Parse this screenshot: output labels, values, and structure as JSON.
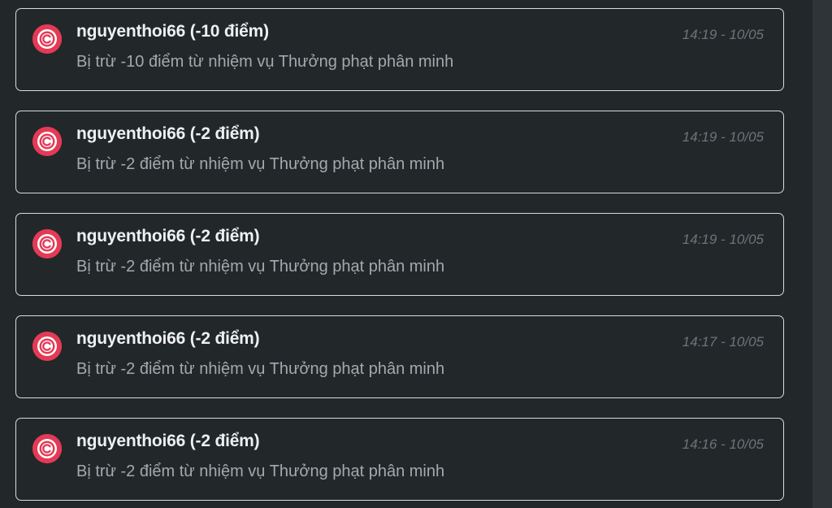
{
  "notifications": [
    {
      "title": "nguyenthoi66 (-10 điểm)",
      "description": "Bị trừ -10 điểm từ nhiệm vụ Thưởng phạt phân minh",
      "time": "14:19 - 10/05",
      "avatar_icon": "red-target-c-logo-icon"
    },
    {
      "title": "nguyenthoi66 (-2 điểm)",
      "description": "Bị trừ -2 điểm từ nhiệm vụ Thưởng phạt phân minh",
      "time": "14:19 - 10/05",
      "avatar_icon": "red-target-c-logo-icon"
    },
    {
      "title": "nguyenthoi66 (-2 điểm)",
      "description": "Bị trừ -2 điểm từ nhiệm vụ Thưởng phạt phân minh",
      "time": "14:19 - 10/05",
      "avatar_icon": "red-target-c-logo-icon"
    },
    {
      "title": "nguyenthoi66 (-2 điểm)",
      "description": "Bị trừ -2 điểm từ nhiệm vụ Thưởng phạt phân minh",
      "time": "14:17 - 10/05",
      "avatar_icon": "red-target-c-logo-icon"
    },
    {
      "title": "nguyenthoi66 (-2 điểm)",
      "description": "Bị trừ -2 điểm từ nhiệm vụ Thưởng phạt phân minh",
      "time": "14:16 - 10/05",
      "avatar_icon": "red-target-c-logo-icon"
    }
  ],
  "colors": {
    "background": "#22272a",
    "card_border": "#d9dcdd",
    "title": "#eef0f1",
    "description": "#a3a9ac",
    "time": "#6d7478",
    "avatar_red": "#e43a56"
  }
}
